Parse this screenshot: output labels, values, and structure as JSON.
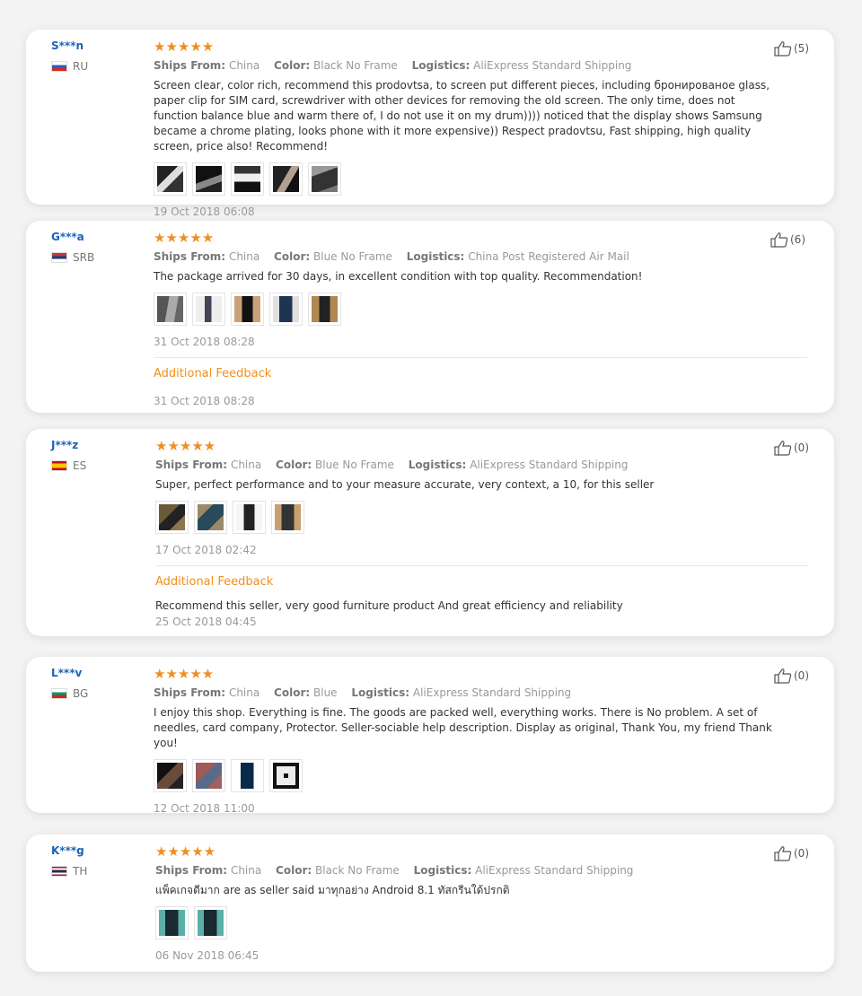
{
  "labels": {
    "ships_from": "Ships From:",
    "color": "Color:",
    "logistics": "Logistics:",
    "additional_feedback": "Additional Feedback"
  },
  "accent_color": "#f28e1c",
  "name_color": "#1a63b7",
  "reviews": [
    {
      "user": "S***n",
      "country": "RU",
      "stars": "★★★★★",
      "rating": 5,
      "helpful": "(5)",
      "ships_from": "China",
      "color": "Black No Frame",
      "logistics": "AliExpress Standard Shipping",
      "text": "Screen clear, color rich, recommend this prodovtsa, to screen put different pieces, including бронированое glass, paper clip for SIM card, screwdriver with other devices for removing the old screen. The only time, does not function balance blue and warm there of, I do not use it on my drum)))) noticed that the display shows Samsung became a chrome plating, looks phone with it more expensive)) Respect pradovtsu, Fast shipping, high quality screen, price also! Recommend!",
      "date": "19 Oct 2018 06:08"
    },
    {
      "user": "G***a",
      "country": "SRB",
      "stars": "★★★★★",
      "rating": 5,
      "helpful": "(6)",
      "ships_from": "China",
      "color": "Blue No Frame",
      "logistics": "China Post Registered Air Mail",
      "text": "The package arrived for 30 days, in excellent condition with top quality. Recommendation!",
      "date": "31 Oct 2018 08:28",
      "feedback_text": "",
      "feedback_date": "31 Oct 2018 08:28"
    },
    {
      "user": "J***z",
      "country": "ES",
      "stars": "★★★★★",
      "rating": 5,
      "helpful": "(0)",
      "ships_from": "China",
      "color": "Blue No Frame",
      "logistics": "AliExpress Standard Shipping",
      "text": "Super, perfect performance and to your measure accurate, very context, a 10, for this seller",
      "date": "17 Oct 2018 02:42",
      "feedback_text": "Recommend this seller, very good furniture product And great efficiency and reliability",
      "feedback_date": "25 Oct 2018 04:45"
    },
    {
      "user": "L***v",
      "country": "BG",
      "stars": "★★★★★",
      "rating": 5,
      "helpful": "(0)",
      "ships_from": "China",
      "color": "Blue",
      "logistics": "AliExpress Standard Shipping",
      "text": "I enjoy this shop. Everything is fine. The goods are packed well, everything works. There is No problem. A set of needles, card company, Protector. Seller-sociable help description. Display as original, Thank You, my friend Thank you!",
      "date": "12 Oct 2018 11:00"
    },
    {
      "user": "K***g",
      "country": "TH",
      "stars": "★★★★★",
      "rating": 5,
      "helpful": "(0)",
      "ships_from": "China",
      "color": "Black No Frame",
      "logistics": "AliExpress Standard Shipping",
      "text": "แพ็คเกจดีมาก are as seller said มาทุกอย่าง Android 8.1 ทัสกรีนใด้ปรกติ",
      "date": "06 Nov 2018 06:45"
    }
  ]
}
